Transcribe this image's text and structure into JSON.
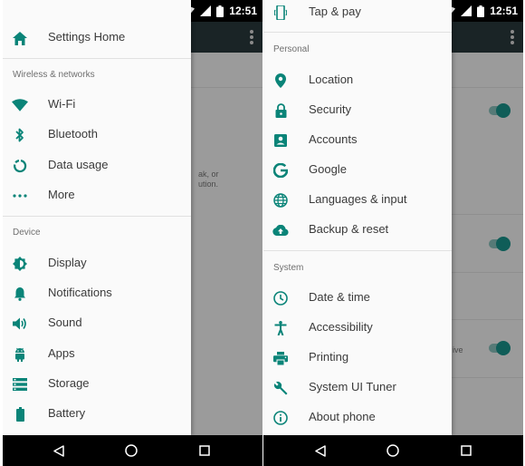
{
  "accent_color": "#0a8478",
  "status_bar": {
    "time": "12:51"
  },
  "left_drawer": {
    "home": {
      "label": "Settings Home",
      "icon": "home-icon"
    },
    "sections": [
      {
        "title": "Wireless & networks",
        "items": [
          {
            "label": "Wi-Fi",
            "icon": "wifi-icon"
          },
          {
            "label": "Bluetooth",
            "icon": "bluetooth-icon"
          },
          {
            "label": "Data usage",
            "icon": "data-usage-icon"
          },
          {
            "label": "More",
            "icon": "more-horizontal-icon"
          }
        ]
      },
      {
        "title": "Device",
        "items": [
          {
            "label": "Display",
            "icon": "brightness-icon"
          },
          {
            "label": "Notifications",
            "icon": "bell-icon"
          },
          {
            "label": "Sound",
            "icon": "volume-icon"
          },
          {
            "label": "Apps",
            "icon": "android-icon"
          },
          {
            "label": "Storage",
            "icon": "storage-icon"
          },
          {
            "label": "Battery",
            "icon": "battery-icon"
          }
        ]
      }
    ]
  },
  "right_drawer": {
    "partial_item": {
      "label": "Tap & pay",
      "icon": "tap-pay-icon"
    },
    "sections": [
      {
        "title": "Personal",
        "items": [
          {
            "label": "Location",
            "icon": "location-pin-icon"
          },
          {
            "label": "Security",
            "icon": "lock-icon"
          },
          {
            "label": "Accounts",
            "icon": "account-box-icon"
          },
          {
            "label": "Google",
            "icon": "google-icon"
          },
          {
            "label": "Languages & input",
            "icon": "globe-icon"
          },
          {
            "label": "Backup & reset",
            "icon": "cloud-upload-icon"
          }
        ]
      },
      {
        "title": "System",
        "items": [
          {
            "label": "Date & time",
            "icon": "clock-icon"
          },
          {
            "label": "Accessibility",
            "icon": "accessibility-icon"
          },
          {
            "label": "Printing",
            "icon": "printer-icon"
          },
          {
            "label": "System UI Tuner",
            "icon": "wrench-icon"
          },
          {
            "label": "About phone",
            "icon": "info-icon"
          }
        ]
      }
    ]
  },
  "background_screen": {
    "text_fragments": [
      "ak, or",
      "ution.",
      "ive"
    ]
  }
}
